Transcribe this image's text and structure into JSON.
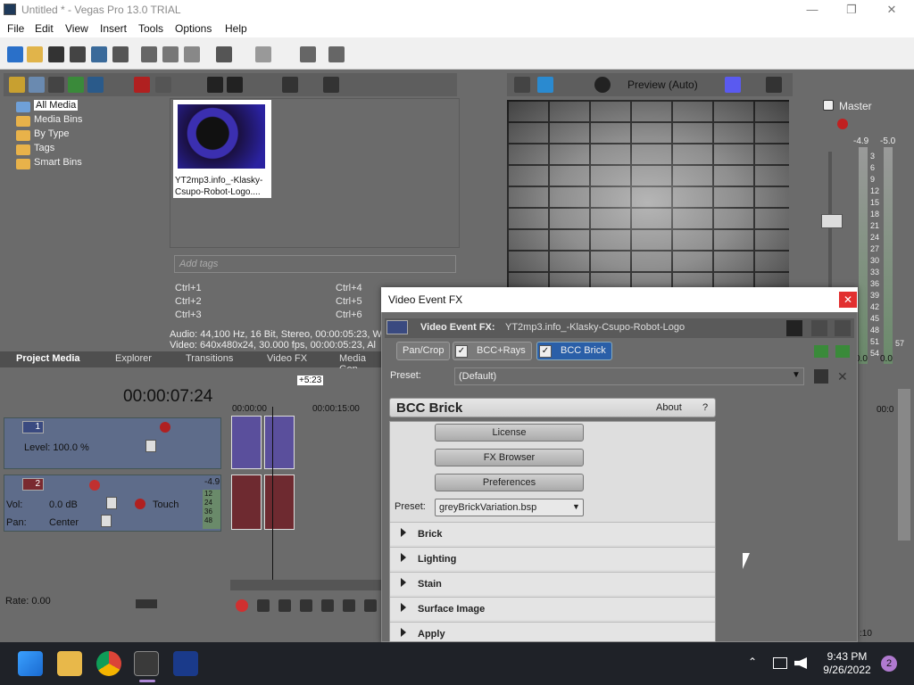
{
  "window": {
    "title": "Untitled * - Vegas Pro 13.0 TRIAL",
    "min": "—",
    "restore": "❐",
    "close": "✕"
  },
  "menu": [
    "File",
    "Edit",
    "View",
    "Insert",
    "Tools",
    "Options",
    "Help"
  ],
  "media_tree": [
    "All Media",
    "Media Bins",
    "By Type",
    "Tags",
    "Smart Bins"
  ],
  "tree_expander": "+",
  "media_item": {
    "caption": "YT2mp3.info_-Klasky-Csupo-Robot-Logo...."
  },
  "tags_placeholder": "Add tags",
  "shortcuts": [
    "Ctrl+1",
    "Ctrl+4",
    "Ctrl+2",
    "Ctrl+5",
    "Ctrl+3",
    "Ctrl+6"
  ],
  "media_info": {
    "audio": "Audio: 44,100 Hz, 16 Bit, Stereo, 00:00:05:23, W",
    "video": "Video: 640x480x24, 30.000 fps, 00:00:05:23, Al"
  },
  "tabs": [
    "Project Media",
    "Explorer",
    "Transitions",
    "Video FX",
    "Media Gen"
  ],
  "preview": {
    "label": "Preview (Auto)"
  },
  "master": {
    "title": "Master",
    "left_db": "-4.9",
    "right_db": "-5.0",
    "ticks": [
      "3",
      "6",
      "9",
      "12",
      "15",
      "18",
      "21",
      "24",
      "27",
      "30",
      "33",
      "36",
      "39",
      "42",
      "45",
      "48",
      "51",
      "54",
      "57"
    ],
    "bottom": [
      "0.0",
      "0.0"
    ]
  },
  "timeline": {
    "timecode": "00:00:07:24",
    "ruler_start": "00:00:00",
    "ruler_mid": "00:00:15:00",
    "ruler_right": "00:0",
    "marker": "+5:23",
    "rate": "Rate: 0.00",
    "tick_end": ":10"
  },
  "track1": {
    "num": "1",
    "level": "Level: 100.0 %"
  },
  "track2": {
    "num": "2",
    "vol_label": "Vol:",
    "vol": "0.0 dB",
    "pan_label": "Pan:",
    "pan": "Center",
    "mode": "Touch",
    "peak": "-4.9",
    "meter_ticks": [
      "12",
      "24",
      "36",
      "48"
    ]
  },
  "vfx": {
    "title": "Video Event FX",
    "head_label": "Video Event FX:",
    "head_value": "YT2mp3.info_-Klasky-Csupo-Robot-Logo",
    "chain": [
      "Pan/Crop",
      "BCC+Rays",
      "BCC Brick"
    ],
    "preset_label": "Preset:",
    "preset_value": "(Default)",
    "bcc_title": "BCC Brick",
    "about": "About",
    "help": "?",
    "buttons": [
      "License",
      "FX Browser",
      "Preferences"
    ],
    "bcc_preset_label": "Preset:",
    "bcc_preset_value": "greyBrickVariation.bsp",
    "sections": [
      "Brick",
      "Lighting",
      "Stain",
      "Surface Image",
      "Apply"
    ]
  },
  "taskbar": {
    "time": "9:43 PM",
    "date": "9/26/2022",
    "notifications": "2"
  }
}
